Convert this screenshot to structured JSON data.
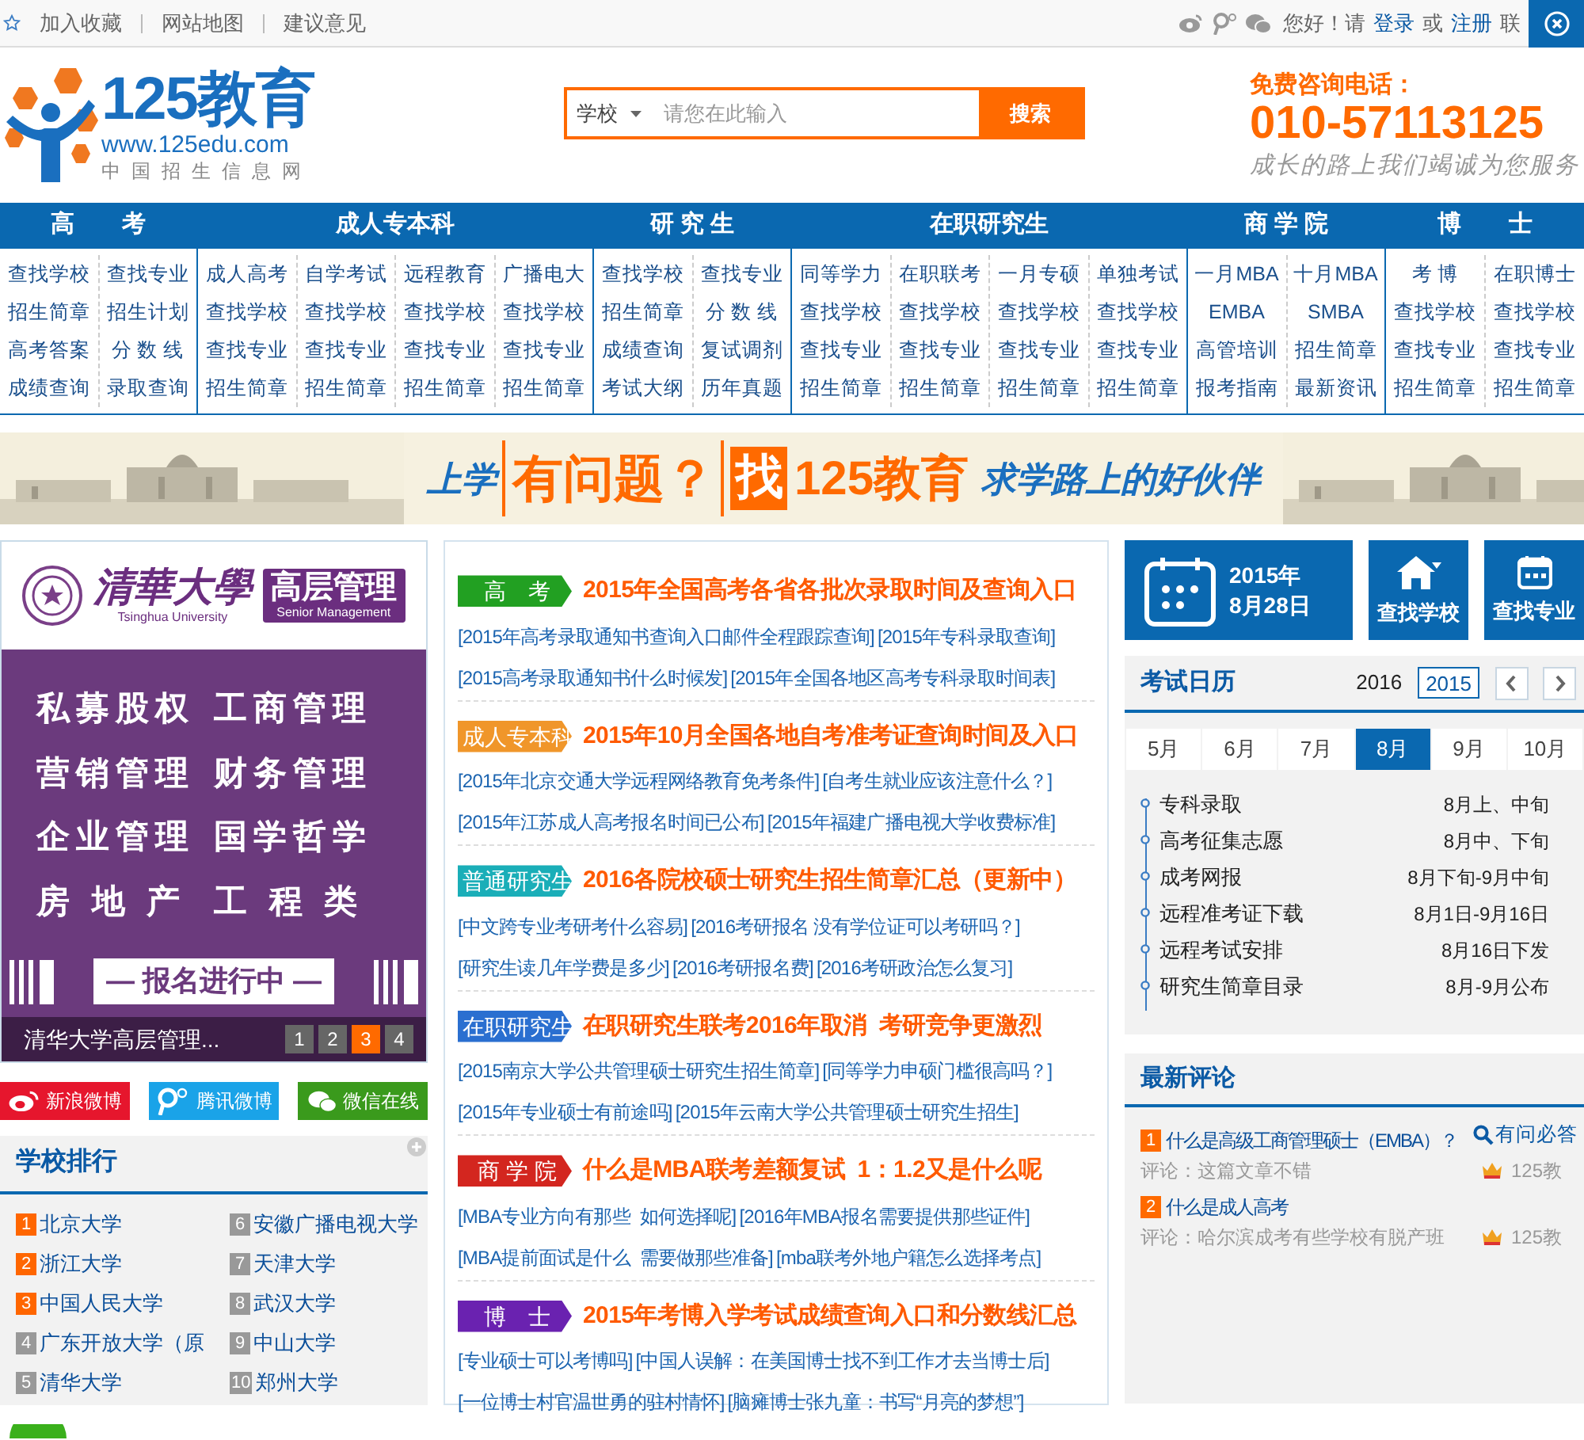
{
  "top_bar": {
    "links": [
      "加入收藏",
      "网站地图",
      "建议意见"
    ],
    "greeting": "您好！请",
    "login": "登录",
    "or": "或",
    "register": "注册",
    "contact": "联"
  },
  "header": {
    "logo_name": "125教育",
    "logo_url": "www.125edu.com",
    "logo_tagline": "中国招生信息网",
    "search": {
      "category": "学校",
      "placeholder": "请您在此输入",
      "button": "搜索"
    },
    "hotline_label": "免费咨询电话：",
    "hotline": "010-57113125",
    "slogan": "成长的路上我们竭诚为您服务"
  },
  "nav": [
    {
      "title": "高　　考",
      "columns": [
        [
          "查找学校",
          "招生简章",
          "高考答案",
          "成绩查询"
        ],
        [
          "查找专业",
          "招生计划",
          "分 数 线",
          "录取查询"
        ]
      ]
    },
    {
      "title": "成人专本科",
      "columns": [
        [
          "成人高考",
          "查找学校",
          "查找专业",
          "招生简章"
        ],
        [
          "自学考试",
          "查找学校",
          "查找专业",
          "招生简章"
        ],
        [
          "远程教育",
          "查找学校",
          "查找专业",
          "招生简章"
        ],
        [
          "广播电大",
          "查找学校",
          "查找专业",
          "招生简章"
        ]
      ]
    },
    {
      "title": "研 究 生",
      "columns": [
        [
          "查找学校",
          "招生简章",
          "成绩查询",
          "考试大纲"
        ],
        [
          "查找专业",
          "分 数 线",
          "复试调剂",
          "历年真题"
        ]
      ]
    },
    {
      "title": "在职研究生",
      "columns": [
        [
          "同等学力",
          "查找学校",
          "查找专业",
          "招生简章"
        ],
        [
          "在职联考",
          "查找学校",
          "查找专业",
          "招生简章"
        ],
        [
          "一月专硕",
          "查找学校",
          "查找专业",
          "招生简章"
        ],
        [
          "单独考试",
          "查找学校",
          "查找专业",
          "招生简章"
        ]
      ]
    },
    {
      "title": "商 学 院",
      "columns": [
        [
          "一月MBA",
          "EMBA",
          "高管培训",
          "报考指南"
        ],
        [
          "十月MBA",
          "SMBA",
          "招生简章",
          "最新资讯"
        ]
      ]
    },
    {
      "title": "博　　士",
      "columns": [
        [
          "考 博",
          "查找学校",
          "查找专业",
          "招生简章"
        ],
        [
          "在职博士",
          "查找学校",
          "查找专业",
          "招生简章"
        ]
      ]
    }
  ],
  "banner": {
    "lead": "上学",
    "question": "有问题？",
    "find": "找",
    "brand": "125教育",
    "motto": "求学路上的好伙伴"
  },
  "ad": {
    "school": "清華大學",
    "school_en": "Tsinghua University",
    "program": "高层管理",
    "program_en": "Senior Management",
    "courses": [
      "私募股权",
      "工商管理",
      "营销管理",
      "财务管理",
      "企业管理",
      "国学哲学",
      "房 地 产",
      "工 程 类"
    ],
    "cta": "— 报名进行中 —",
    "caption": "清华大学高层管理...",
    "pages": [
      {
        "label": "1",
        "selected": false
      },
      {
        "label": "2",
        "selected": false
      },
      {
        "label": "3",
        "selected": true
      },
      {
        "label": "4",
        "selected": false
      }
    ]
  },
  "social": [
    {
      "kind": "weibo",
      "label": "新浪微博"
    },
    {
      "kind": "tencent",
      "label": "腾讯微博"
    },
    {
      "kind": "wechat",
      "label": "微信在线"
    }
  ],
  "ranking": {
    "title": "学校排行",
    "items": [
      {
        "num": "1",
        "name": "北京大学",
        "color": "#ff6600"
      },
      {
        "num": "2",
        "name": "浙江大学",
        "color": "#ff6600"
      },
      {
        "num": "3",
        "name": "中国人民大学",
        "color": "#ff6600"
      },
      {
        "num": "4",
        "name": "广东开放大学（原",
        "color": "#999999"
      },
      {
        "num": "5",
        "name": "清华大学",
        "color": "#999999"
      },
      {
        "num": "6",
        "name": "安徽广播电视大学",
        "color": "#999999"
      },
      {
        "num": "7",
        "name": "天津大学",
        "color": "#999999"
      },
      {
        "num": "8",
        "name": "武汉大学",
        "color": "#999999"
      },
      {
        "num": "9",
        "name": "中山大学",
        "color": "#999999"
      },
      {
        "num": "10",
        "name": "郑州大学",
        "color": "#999999"
      }
    ]
  },
  "news": [
    {
      "tag": "高　考",
      "color": "#22a022",
      "headline": "2015年全国高考各省各批次录取时间及查询入口",
      "lines": [
        [
          "[2015年高考录取通知书查询入口邮件全程跟踪查询]",
          "[2015年专科录取查询]"
        ],
        [
          "[2015高考录取通知书什么时候发]",
          "[2015年全国各地区高考专科录取时间表]"
        ]
      ]
    },
    {
      "tag": "成人专本科",
      "color": "#f0962a",
      "headline": "2015年10月全国各地自考准考证查询时间及入口",
      "lines": [
        [
          "[2015年北京交通大学远程网络教育免考条件]",
          "[自考生就业应该注意什么？]"
        ],
        [
          "[2015年江苏成人高考报名时间已公布]",
          "[2015年福建广播电视大学收费标准]"
        ]
      ]
    },
    {
      "tag": "普通研究生",
      "color": "#1aaeb8",
      "headline": "2016各院校硕士研究生招生简章汇总（更新中）",
      "lines": [
        [
          "[中文跨专业考研考什么容易]",
          "[2016考研报名 没有学位证可以考研吗？]"
        ],
        [
          "[研究生读几年学费是多少]",
          "[2016考研报名费]",
          "[2016考研政治怎么复习]"
        ]
      ]
    },
    {
      "tag": "在职研究生",
      "color": "#2a6fd0",
      "headline": "在职研究生联考2016年取消  考研竞争更激烈",
      "lines": [
        [
          "[2015南京大学公共管理硕士研究生招生简章]",
          "[同等学力申硕门槛很高吗？]"
        ],
        [
          "[2015年专业硕士有前途吗]",
          "[2015年云南大学公共管理硕士研究生招生]"
        ]
      ]
    },
    {
      "tag": "商 学 院",
      "color": "#d3261f",
      "headline": "什么是MBA联考差额复试  1：1.2又是什么呢",
      "lines": [
        [
          "[MBA专业方向有那些  如何选择呢]",
          "[2016年MBA报名需要提供那些证件]"
        ],
        [
          "[MBA提前面试是什么  需要做那些准备]",
          "[mba联考外地户籍怎么选择考点]"
        ]
      ]
    },
    {
      "tag": "博　士",
      "color": "#6a22b0",
      "headline": "2015年考博入学考试成绩查询入口和分数线汇总",
      "lines": [
        [
          "[专业硕士可以考博吗]",
          "[中国人误解：在美国博士找不到工作才去当博士后]"
        ],
        [
          "[一位博士村官温世勇的驻村情怀]",
          "[脑瘫博士张九童：书写“月亮的梦想”]"
        ]
      ]
    }
  ],
  "date_card": {
    "year": "2015年",
    "day": "8月28日"
  },
  "quick_links": [
    {
      "kind": "school",
      "label": "查找学校"
    },
    {
      "kind": "major",
      "label": "查找专业"
    }
  ],
  "exam_calendar": {
    "title": "考试日历",
    "years": [
      {
        "label": "2016",
        "selected": false
      },
      {
        "label": "2015",
        "selected": true
      }
    ],
    "months": [
      {
        "label": "5月",
        "selected": false
      },
      {
        "label": "6月",
        "selected": false
      },
      {
        "label": "7月",
        "selected": false
      },
      {
        "label": "8月",
        "selected": true
      },
      {
        "label": "9月",
        "selected": false
      },
      {
        "label": "10月",
        "selected": false
      }
    ],
    "events": [
      {
        "name": "专科录取",
        "time": "8月上、中旬"
      },
      {
        "name": "高考征集志愿",
        "time": "8月中、下旬"
      },
      {
        "name": "成考网报",
        "time": "8月下旬-9月中旬"
      },
      {
        "name": "远程准考证下载",
        "time": "8月1日-9月16日"
      },
      {
        "name": "远程考试安排",
        "time": "8月16日下发"
      },
      {
        "name": "研究生简章目录",
        "time": "8月-9月公布"
      }
    ]
  },
  "comments": {
    "title": "最新评论",
    "ask": "有问必答",
    "items": [
      {
        "num": "1",
        "title": "什么是高级工商管理硕士（EMBA）？",
        "comment": "评论：这篇文章不错",
        "author": "125教"
      },
      {
        "num": "2",
        "title": "什么是成人高考",
        "comment": "评论：哈尔滨成考有些学校有脱产班",
        "author": "125教"
      }
    ]
  }
}
